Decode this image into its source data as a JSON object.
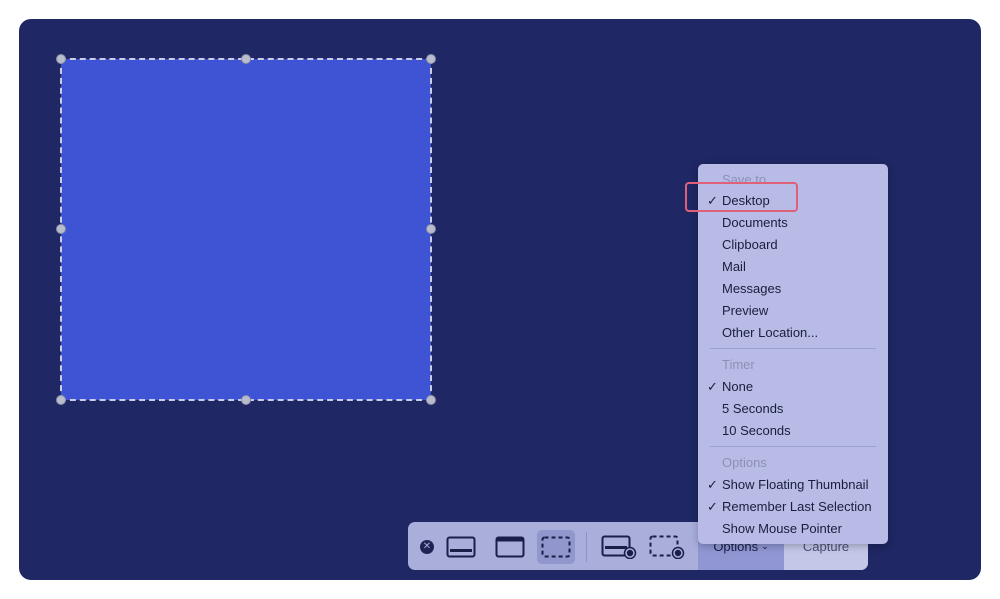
{
  "toolbar": {
    "close_icon": "close-icon",
    "tools": [
      "capture-entire-screen-icon",
      "capture-window-icon",
      "capture-selection-icon",
      "record-screen-icon",
      "record-selection-icon"
    ],
    "options_label": "Options",
    "capture_label": "Capture"
  },
  "menu": {
    "save_to_header": "Save to",
    "save_to_items": [
      "Desktop",
      "Documents",
      "Clipboard",
      "Mail",
      "Messages",
      "Preview",
      "Other Location..."
    ],
    "timer_header": "Timer",
    "timer_items": [
      "None",
      "5 Seconds",
      "10 Seconds"
    ],
    "options_header": "Options",
    "options_items": [
      "Show Floating Thumbnail",
      "Remember Last Selection",
      "Show Mouse Pointer"
    ],
    "checked": [
      "Desktop",
      "None",
      "Show Floating Thumbnail",
      "Remember Last Selection"
    ]
  },
  "colors": {
    "background": "#1f2764",
    "selection": "#3e54d4",
    "menu": "#b7bbe6",
    "highlight": "#e0607a"
  }
}
